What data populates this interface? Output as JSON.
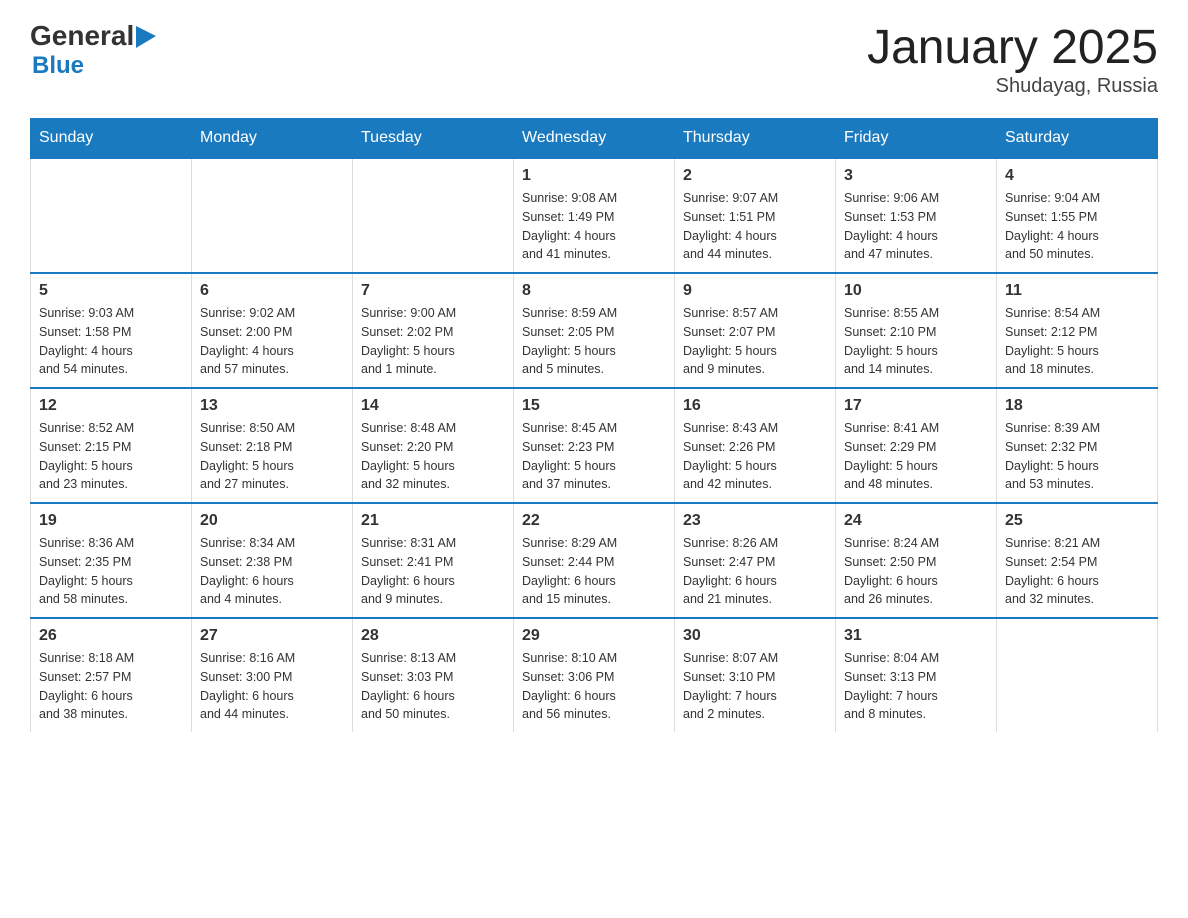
{
  "logo": {
    "general": "General",
    "blue": "Blue",
    "arrow": "▶"
  },
  "title": {
    "month_year": "January 2025",
    "location": "Shudayag, Russia"
  },
  "weekdays": [
    "Sunday",
    "Monday",
    "Tuesday",
    "Wednesday",
    "Thursday",
    "Friday",
    "Saturday"
  ],
  "weeks": [
    [
      {
        "day": "",
        "info": ""
      },
      {
        "day": "",
        "info": ""
      },
      {
        "day": "",
        "info": ""
      },
      {
        "day": "1",
        "info": "Sunrise: 9:08 AM\nSunset: 1:49 PM\nDaylight: 4 hours\nand 41 minutes."
      },
      {
        "day": "2",
        "info": "Sunrise: 9:07 AM\nSunset: 1:51 PM\nDaylight: 4 hours\nand 44 minutes."
      },
      {
        "day": "3",
        "info": "Sunrise: 9:06 AM\nSunset: 1:53 PM\nDaylight: 4 hours\nand 47 minutes."
      },
      {
        "day": "4",
        "info": "Sunrise: 9:04 AM\nSunset: 1:55 PM\nDaylight: 4 hours\nand 50 minutes."
      }
    ],
    [
      {
        "day": "5",
        "info": "Sunrise: 9:03 AM\nSunset: 1:58 PM\nDaylight: 4 hours\nand 54 minutes."
      },
      {
        "day": "6",
        "info": "Sunrise: 9:02 AM\nSunset: 2:00 PM\nDaylight: 4 hours\nand 57 minutes."
      },
      {
        "day": "7",
        "info": "Sunrise: 9:00 AM\nSunset: 2:02 PM\nDaylight: 5 hours\nand 1 minute."
      },
      {
        "day": "8",
        "info": "Sunrise: 8:59 AM\nSunset: 2:05 PM\nDaylight: 5 hours\nand 5 minutes."
      },
      {
        "day": "9",
        "info": "Sunrise: 8:57 AM\nSunset: 2:07 PM\nDaylight: 5 hours\nand 9 minutes."
      },
      {
        "day": "10",
        "info": "Sunrise: 8:55 AM\nSunset: 2:10 PM\nDaylight: 5 hours\nand 14 minutes."
      },
      {
        "day": "11",
        "info": "Sunrise: 8:54 AM\nSunset: 2:12 PM\nDaylight: 5 hours\nand 18 minutes."
      }
    ],
    [
      {
        "day": "12",
        "info": "Sunrise: 8:52 AM\nSunset: 2:15 PM\nDaylight: 5 hours\nand 23 minutes."
      },
      {
        "day": "13",
        "info": "Sunrise: 8:50 AM\nSunset: 2:18 PM\nDaylight: 5 hours\nand 27 minutes."
      },
      {
        "day": "14",
        "info": "Sunrise: 8:48 AM\nSunset: 2:20 PM\nDaylight: 5 hours\nand 32 minutes."
      },
      {
        "day": "15",
        "info": "Sunrise: 8:45 AM\nSunset: 2:23 PM\nDaylight: 5 hours\nand 37 minutes."
      },
      {
        "day": "16",
        "info": "Sunrise: 8:43 AM\nSunset: 2:26 PM\nDaylight: 5 hours\nand 42 minutes."
      },
      {
        "day": "17",
        "info": "Sunrise: 8:41 AM\nSunset: 2:29 PM\nDaylight: 5 hours\nand 48 minutes."
      },
      {
        "day": "18",
        "info": "Sunrise: 8:39 AM\nSunset: 2:32 PM\nDaylight: 5 hours\nand 53 minutes."
      }
    ],
    [
      {
        "day": "19",
        "info": "Sunrise: 8:36 AM\nSunset: 2:35 PM\nDaylight: 5 hours\nand 58 minutes."
      },
      {
        "day": "20",
        "info": "Sunrise: 8:34 AM\nSunset: 2:38 PM\nDaylight: 6 hours\nand 4 minutes."
      },
      {
        "day": "21",
        "info": "Sunrise: 8:31 AM\nSunset: 2:41 PM\nDaylight: 6 hours\nand 9 minutes."
      },
      {
        "day": "22",
        "info": "Sunrise: 8:29 AM\nSunset: 2:44 PM\nDaylight: 6 hours\nand 15 minutes."
      },
      {
        "day": "23",
        "info": "Sunrise: 8:26 AM\nSunset: 2:47 PM\nDaylight: 6 hours\nand 21 minutes."
      },
      {
        "day": "24",
        "info": "Sunrise: 8:24 AM\nSunset: 2:50 PM\nDaylight: 6 hours\nand 26 minutes."
      },
      {
        "day": "25",
        "info": "Sunrise: 8:21 AM\nSunset: 2:54 PM\nDaylight: 6 hours\nand 32 minutes."
      }
    ],
    [
      {
        "day": "26",
        "info": "Sunrise: 8:18 AM\nSunset: 2:57 PM\nDaylight: 6 hours\nand 38 minutes."
      },
      {
        "day": "27",
        "info": "Sunrise: 8:16 AM\nSunset: 3:00 PM\nDaylight: 6 hours\nand 44 minutes."
      },
      {
        "day": "28",
        "info": "Sunrise: 8:13 AM\nSunset: 3:03 PM\nDaylight: 6 hours\nand 50 minutes."
      },
      {
        "day": "29",
        "info": "Sunrise: 8:10 AM\nSunset: 3:06 PM\nDaylight: 6 hours\nand 56 minutes."
      },
      {
        "day": "30",
        "info": "Sunrise: 8:07 AM\nSunset: 3:10 PM\nDaylight: 7 hours\nand 2 minutes."
      },
      {
        "day": "31",
        "info": "Sunrise: 8:04 AM\nSunset: 3:13 PM\nDaylight: 7 hours\nand 8 minutes."
      },
      {
        "day": "",
        "info": ""
      }
    ]
  ]
}
